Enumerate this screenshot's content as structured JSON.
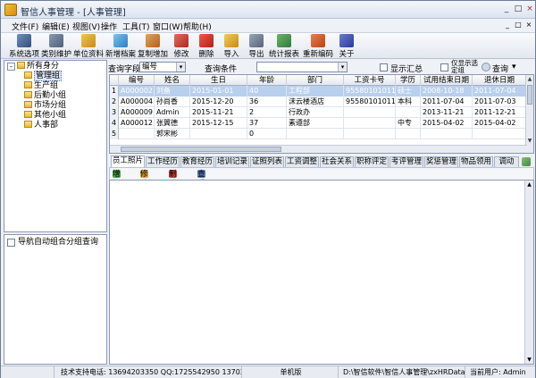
{
  "window": {
    "title": "智信人事管理 - [人事管理]"
  },
  "titlebar_buttons": [
    "_",
    "□",
    "×"
  ],
  "menu": {
    "items": [
      "文件(F)",
      "编辑(E)",
      "视图(V)",
      "操作",
      "工具(T)",
      "窗口(W)",
      "帮助(H)"
    ],
    "mdi_buttons": [
      "_",
      "□",
      "×"
    ]
  },
  "toolbar": {
    "buttons": [
      "系统选项",
      "类别维护",
      "单位资料",
      "新增档案",
      "复制增加",
      "修改",
      "删除",
      "导入",
      "导出",
      "统计报表",
      "重新编码",
      "关于"
    ]
  },
  "tree": {
    "root": "所有身分",
    "expander": "-",
    "nodes": [
      "管理组",
      "生产组",
      "后勤小组",
      "市场分组",
      "其他小组",
      "人事部"
    ]
  },
  "left_bottom": {
    "checkbox_label": "导航自动组合分组查询"
  },
  "query": {
    "field_label": "查询字段",
    "field_value": "编号",
    "cond_label": "查询条件",
    "cond_value": "",
    "show_summary": "显示汇总",
    "only_show_selected": "仅显示选定组",
    "search_btn": "查询",
    "dropdown_arrow": "▾",
    "search_menu_arrow": "▾"
  },
  "grid": {
    "headers": [
      "编号",
      "姓名",
      "生日",
      "年龄",
      "部门",
      "工资卡号",
      "学历",
      "试用结束日期",
      "退休日期"
    ],
    "rows": [
      {
        "n": "1",
        "cells": [
          "A000002",
          "刘备",
          "2015-01-01",
          "40",
          "工程部",
          "955801010111",
          "硕士",
          "2008-10-18",
          "2011-07-04"
        ]
      },
      {
        "n": "2",
        "cells": [
          "A000004",
          "孙尚香",
          "2015-12-20",
          "36",
          "沫云楼酒店",
          "955801010111",
          "本科",
          "2011-07-04",
          "2011-07-03"
        ]
      },
      {
        "n": "3",
        "cells": [
          "A000009",
          "Admin",
          "2015-11-21",
          "2",
          "行政办",
          "",
          "",
          "2013-11-21",
          "2011-12-21"
        ]
      },
      {
        "n": "4",
        "cells": [
          "A000012",
          "张翼德",
          "2015-12-15",
          "37",
          "素遵部",
          "",
          "中专",
          "2015-04-02",
          "2015-04-02"
        ]
      },
      {
        "n": "5",
        "cells": [
          "",
          "郭宋彬",
          "",
          "0",
          "",
          "",
          "",
          "",
          ""
        ]
      }
    ],
    "selected_row": 0,
    "scroll_up": "▲",
    "scroll_down": "▼"
  },
  "tabs": [
    "员工照片",
    "工作经历",
    "教育经历",
    "培训记录",
    "证照列表",
    "工资调整",
    "社会关系",
    "职称评定",
    "考评管理",
    "奖惩管理",
    "物品领用",
    "调动"
  ],
  "tab_active": 0,
  "subtoolbar": {
    "add": "增加",
    "edit": "修改",
    "delete": "删除",
    "view": "查看"
  },
  "detail": {
    "scroll_up": "▲",
    "scroll_down": "▼"
  },
  "status": {
    "support": "技术支持电话: 13694203350 QQ:1725542950 137028856",
    "mode": "单机版",
    "path": "D:\\智信软件\\智信人事管理\\zxHRData.sys",
    "user": "当前用户: Admin"
  },
  "colors": {
    "title_bg": "#dde5f0",
    "selection": "#b9cfee",
    "border": "#8a99b0"
  }
}
